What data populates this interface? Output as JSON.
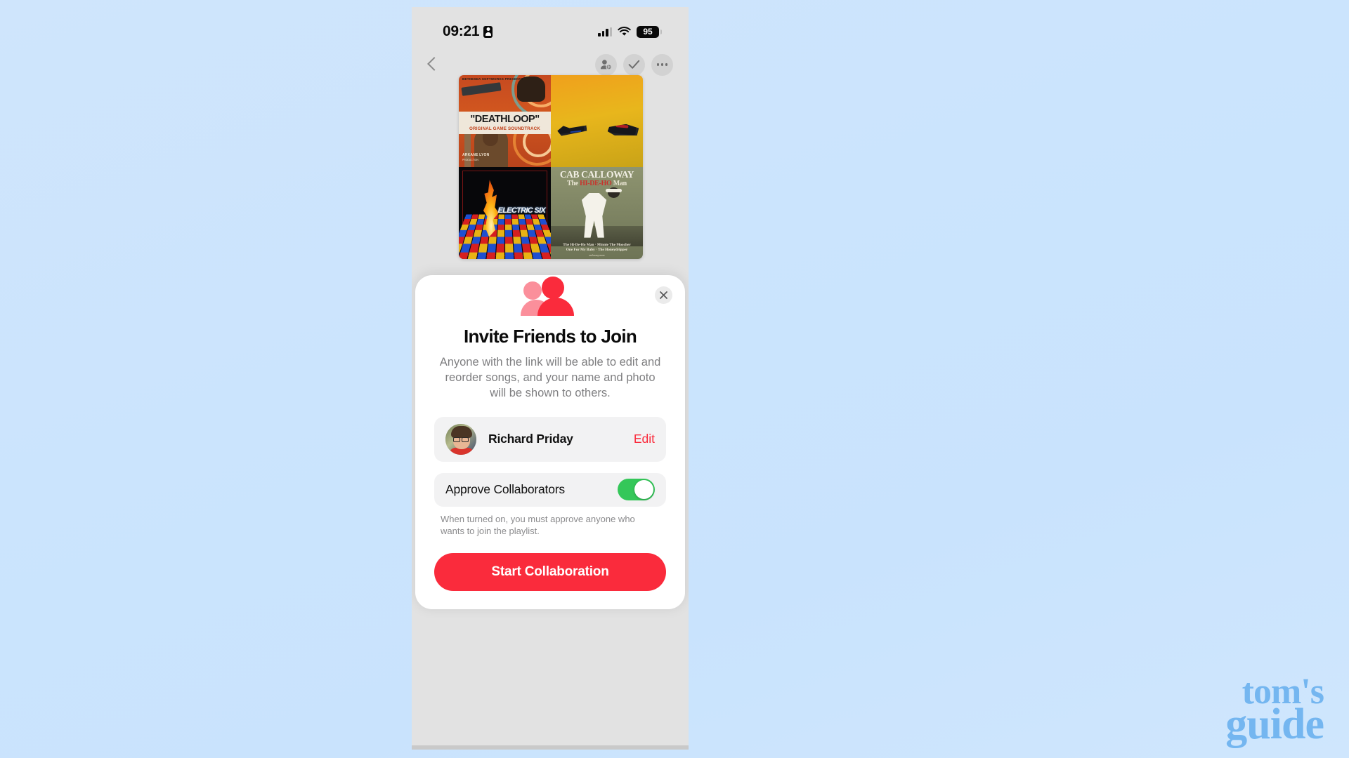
{
  "statusbar": {
    "time": "09:21",
    "recording_icon": "id-card-icon",
    "signal_icon": "cellular-signal-icon",
    "wifi_icon": "wifi-icon",
    "battery_level": "95"
  },
  "navbar": {
    "back_icon": "back-chevron-icon",
    "actions": [
      {
        "icon": "add-person-icon"
      },
      {
        "icon": "checkmark-icon"
      },
      {
        "icon": "more-ellipsis-icon"
      }
    ]
  },
  "artwork": {
    "albums": [
      {
        "id": "deathloop",
        "label_top": "BETHESDA SOFTWORKS PRESENTS",
        "title": "\"DEATHLOOP\"",
        "subtitle": "ORIGINAL GAME SOUNDTRACK",
        "credit": "ARKANE LYON",
        "credit2": "PRODUCTION"
      },
      {
        "id": "run-the-jewels",
        "title": ""
      },
      {
        "id": "electric-six",
        "title": "ELECTRIC SIX"
      },
      {
        "id": "cab-calloway",
        "artist": "CAB CALLOWAY",
        "title_prefix": "The ",
        "title_accent": "HI-DE-HO",
        "title_suffix": " Man",
        "tracks_line1": "The Hi-De-Ho Man · Minnie The Moocher",
        "tracks_line2": "One For My Baby · The Honeydripper",
        "tracks_line3": "and many more"
      }
    ]
  },
  "modal": {
    "close_icon": "close-x-icon",
    "hero_icon": "two-people-icon",
    "title": "Invite Friends to Join",
    "subtitle": "Anyone with the link will be able to edit and reorder songs, and your name and photo will be shown to others.",
    "user_row": {
      "avatar_icon": "user-avatar-photo",
      "name": "Richard Priday",
      "edit_label": "Edit"
    },
    "toggle_row": {
      "label": "Approve Collaborators",
      "state": "on",
      "help_text": "When turned on, you must approve anyone who wants to join the playlist."
    },
    "cta_label": "Start Collaboration"
  },
  "watermark": {
    "line1": "tom's",
    "line2": "guide"
  },
  "colors": {
    "accent_red": "#fa2b3c",
    "toggle_green": "#34c759",
    "page_background": "#cbe4fd",
    "phone_body": "#c9c9c9",
    "app_background": "#e2e2e2",
    "watermark_blue": "#74b6f0"
  }
}
